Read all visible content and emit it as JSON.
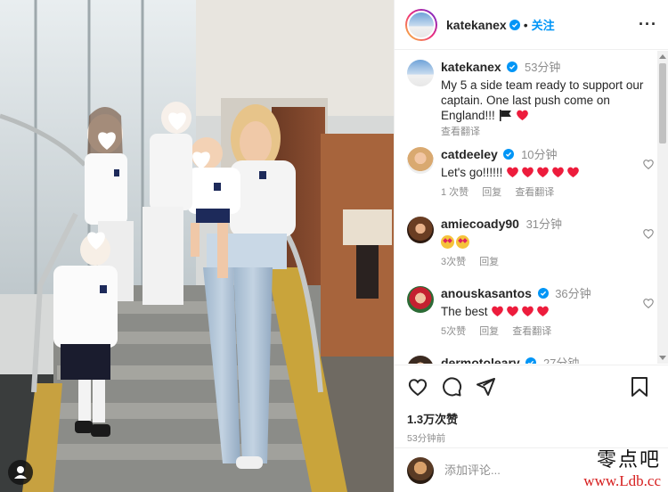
{
  "post": {
    "username": "katekanex",
    "follow_label": "关注",
    "more_label": "···",
    "caption": {
      "username": "katekanex",
      "time": "53分钟",
      "text": "My 5 a side team ready to support our captain. One last push come on England!!!",
      "translate": "查看翻译"
    },
    "likes": "1.3万次赞",
    "time_ago": "53分钟前",
    "add_comment_placeholder": "添加评论..."
  },
  "comments": [
    {
      "username": "catdeeley",
      "verified": true,
      "time": "10分钟",
      "text": "Let's go!!!!!!",
      "hearts": 5,
      "likes": "1 次赞",
      "reply": "回复",
      "translate": "查看翻译"
    },
    {
      "username": "amiecoady90",
      "verified": false,
      "time": "31分钟",
      "text": "",
      "faces": 2,
      "likes": "3次赞",
      "reply": "回复"
    },
    {
      "username": "anouskasantos",
      "verified": true,
      "time": "36分钟",
      "text": "The best",
      "hearts": 4,
      "likes": "5次赞",
      "reply": "回复",
      "translate": "查看翻译"
    },
    {
      "username": "dermotoleary",
      "verified": true,
      "time": "27分钟"
    }
  ],
  "watermark": {
    "chinese": "零点吧",
    "url": "www.Ldb.cc"
  },
  "colors": {
    "accent": "#0095f6",
    "heart": "#ed1c3c",
    "muted": "#8e8e8e"
  },
  "icons": [
    "heart-icon",
    "comment-icon",
    "share-icon",
    "bookmark-icon",
    "verified-icon",
    "more-icon"
  ]
}
